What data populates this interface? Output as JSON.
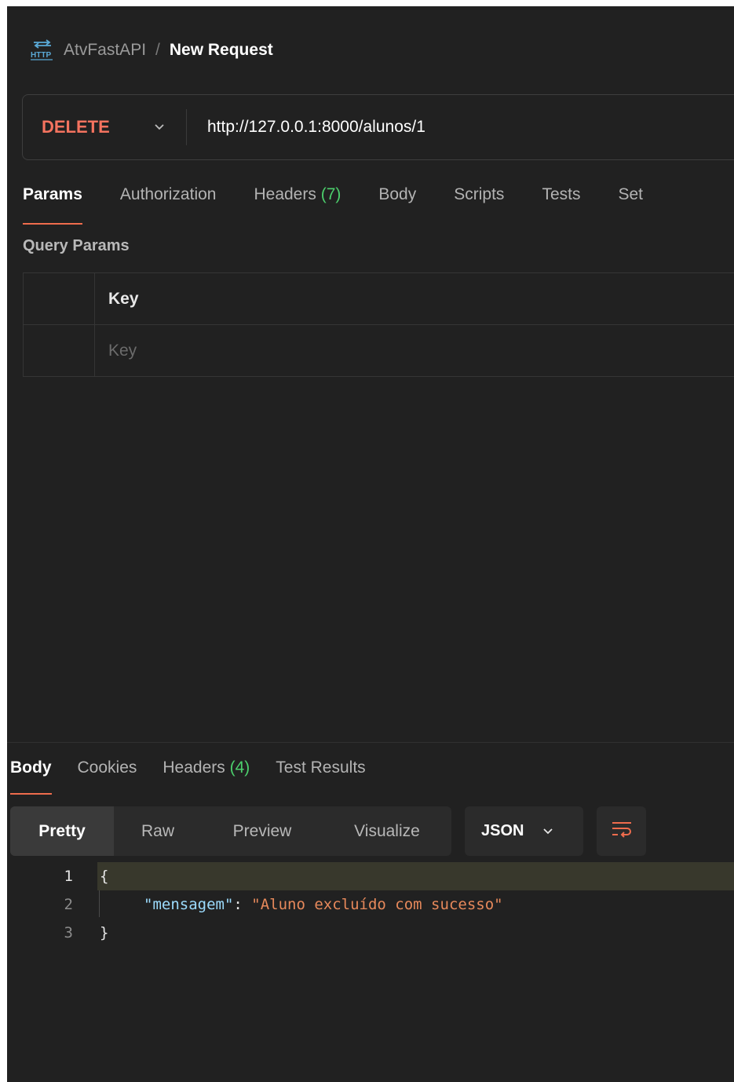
{
  "header": {
    "collection": "AtvFastAPI",
    "separator": "/",
    "request_name": "New Request",
    "icon": "http-icon"
  },
  "request": {
    "method": "DELETE",
    "url": "http://127.0.0.1:8000/alunos/1"
  },
  "request_tabs": {
    "params": "Params",
    "authorization": "Authorization",
    "headers": "Headers",
    "headers_count": "(7)",
    "body": "Body",
    "scripts": "Scripts",
    "tests": "Tests",
    "settings": "Set"
  },
  "query_params": {
    "title": "Query Params",
    "column_key": "Key",
    "key_placeholder": "Key"
  },
  "response_tabs": {
    "body": "Body",
    "cookies": "Cookies",
    "headers": "Headers",
    "headers_count": "(4)",
    "test_results": "Test Results"
  },
  "view_modes": {
    "pretty": "Pretty",
    "raw": "Raw",
    "preview": "Preview",
    "visualize": "Visualize"
  },
  "format": "JSON",
  "response_code": {
    "line_numbers": [
      "1",
      "2",
      "3"
    ],
    "open_brace": "{",
    "key": "\"mensagem\"",
    "colon": ": ",
    "value": "\"Aluno excluído com sucesso\"",
    "close_brace": "}"
  },
  "colors": {
    "background": "#212121",
    "method_delete": "#f5735f",
    "accent": "#ef6c4d",
    "count_green": "#4ccf6c",
    "json_key": "#9cdcfe",
    "json_string": "#e7895b"
  }
}
